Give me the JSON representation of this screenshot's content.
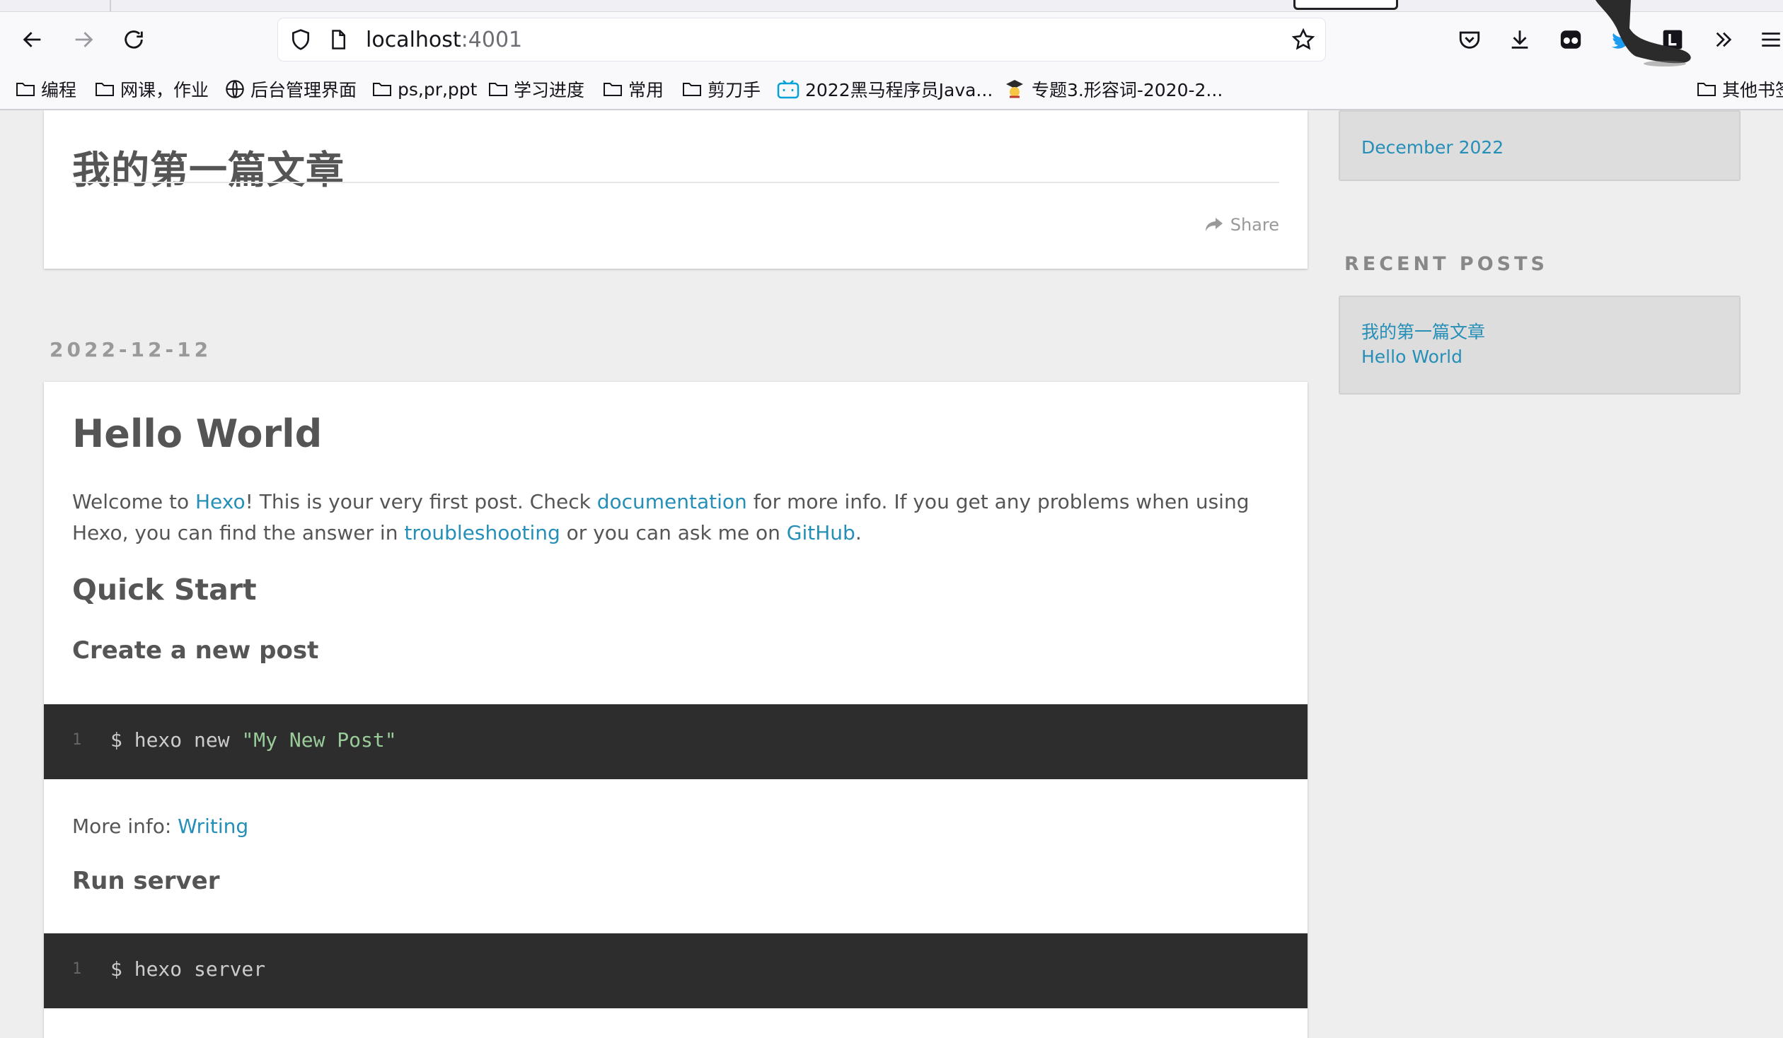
{
  "browser": {
    "url_host": "localhost",
    "url_port": ":4001",
    "icons": [
      "back-arrow-icon",
      "forward-arrow-icon",
      "reload-icon",
      "shield-icon",
      "page-icon",
      "bookmark-star-icon",
      "pocket-icon",
      "download-icon",
      "extension-icon",
      "twitter-extension-icon",
      "l-extension-icon",
      "overflow-chevrons-icon",
      "menu-icon"
    ],
    "bookmarks": [
      {
        "label": "编程",
        "icon": "folder-icon"
      },
      {
        "label": "网课，作业",
        "icon": "folder-icon"
      },
      {
        "label": "后台管理界面",
        "icon": "globe-icon"
      },
      {
        "label": "ps,pr,ppt",
        "icon": "folder-icon"
      },
      {
        "label": "学习进度",
        "icon": "folder-icon"
      },
      {
        "label": "常用",
        "icon": "folder-icon"
      },
      {
        "label": "剪刀手",
        "icon": "folder-icon"
      },
      {
        "label": "2022黑马程序员Java...",
        "icon": "bilibili-icon"
      },
      {
        "label": "专题3.形容词-2020-2...",
        "icon": "scholar-icon"
      },
      {
        "label": "其他书签",
        "icon": "folder-icon"
      }
    ]
  },
  "posts": [
    {
      "title": "我的第一篇文章",
      "share_label": "Share"
    },
    {
      "date": "2022-12-12",
      "title": "Hello World",
      "intro": {
        "t1": "Welcome to ",
        "l1": "Hexo",
        "t2": "! This is your very first post. Check ",
        "l2": "documentation",
        "t3": " for more info. If you get any problems when using Hexo, you can find the answer in ",
        "l3": "troubleshooting",
        "t4": " or you can ask me on ",
        "l4": "GitHub",
        "t5": "."
      },
      "h_quick_start": "Quick Start",
      "h_create_post": "Create a new post",
      "code1": {
        "line_no": "1",
        "cmd": "$ hexo new ",
        "str": "\"My New Post\""
      },
      "more_info_label": "More info: ",
      "more_info_link": "Writing",
      "h_run_server": "Run server",
      "code2": {
        "line_no": "1",
        "cmd": "$ hexo server"
      }
    }
  ],
  "sidebar": {
    "archive_link": "December 2022",
    "recent_title": "RECENT POSTS",
    "recent_posts": [
      "我的第一篇文章",
      "Hello World"
    ]
  },
  "colors": {
    "link": "#258fb8",
    "code_bg": "#2d2d2d",
    "page_bg": "#eeeeee"
  }
}
